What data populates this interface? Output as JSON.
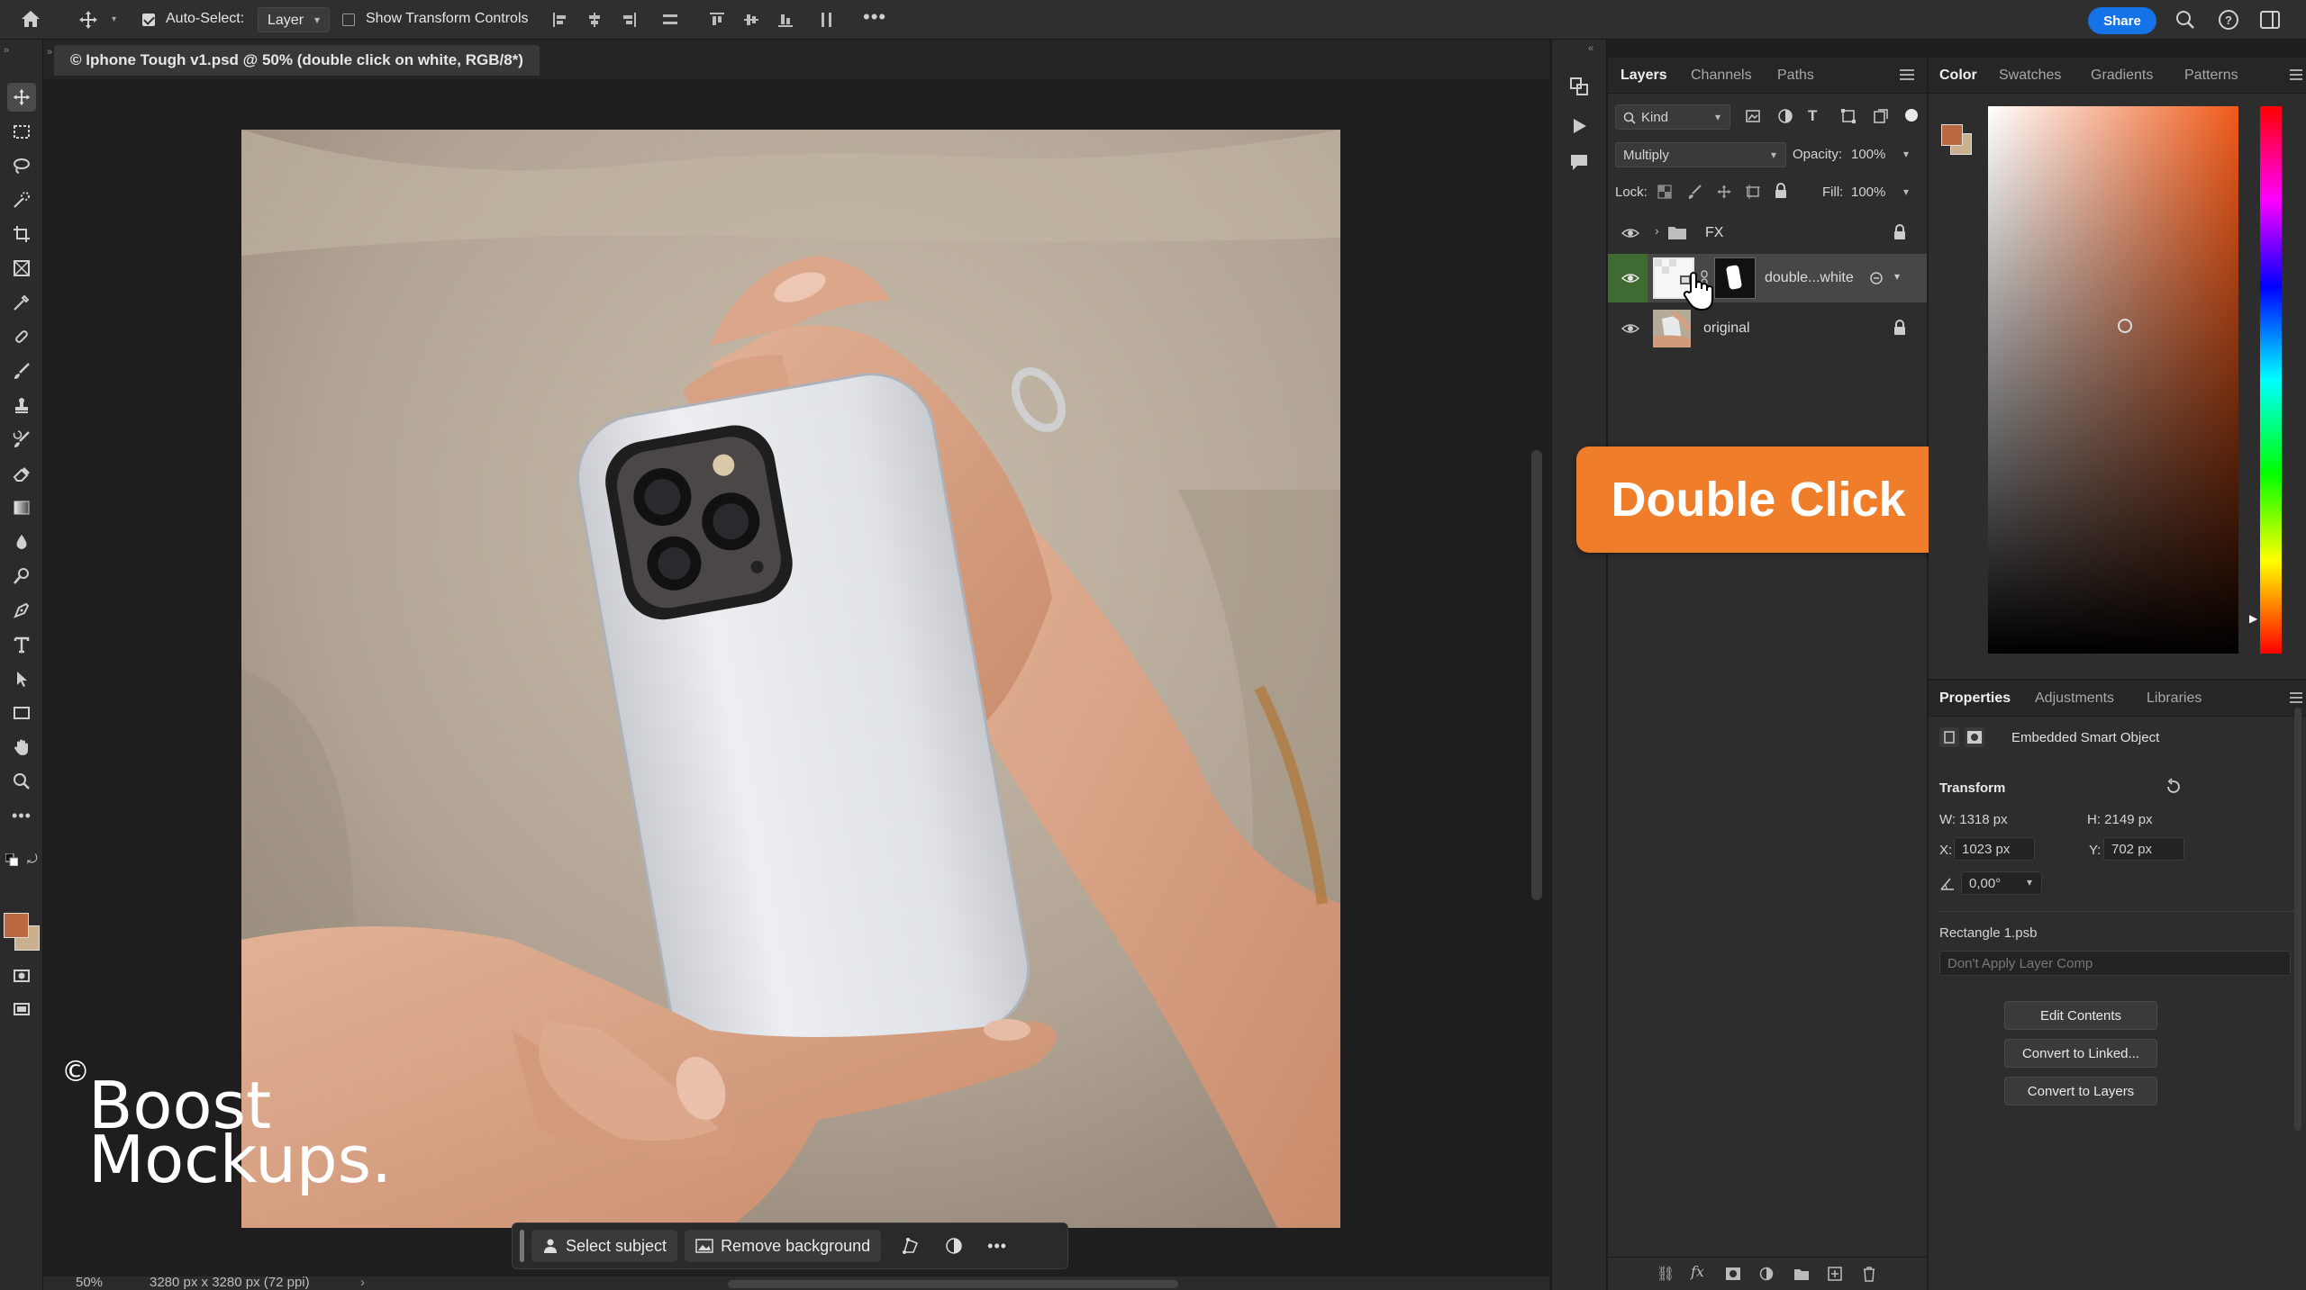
{
  "options_bar": {
    "auto_select_label": "Auto-Select:",
    "auto_select_value": "Layer",
    "show_transform_label": "Show Transform Controls",
    "share_label": "Share"
  },
  "document": {
    "tab_title": "© Iphone Tough v1.psd @ 50% (double click on white, RGB/8*)"
  },
  "contextual_bar": {
    "select_subject": "Select subject",
    "remove_background": "Remove background"
  },
  "status": {
    "zoom": "50%",
    "doc_size": "3280 px x 3280 px (72 ppi)"
  },
  "layers_panel": {
    "tabs": [
      "Layers",
      "Channels",
      "Paths"
    ],
    "filter_kind": "Kind",
    "blend_mode": "Multiply",
    "opacity_label": "Opacity:",
    "opacity_value": "100%",
    "lock_label": "Lock:",
    "fill_label": "Fill:",
    "fill_value": "100%",
    "layers": [
      {
        "name": "FX",
        "type": "group",
        "locked": true,
        "visible": true
      },
      {
        "name": "double...white",
        "type": "smart-object",
        "selected": true,
        "visible": true
      },
      {
        "name": "original",
        "type": "pixel",
        "locked": true,
        "visible": true
      }
    ]
  },
  "color_panel": {
    "tabs": [
      "Color",
      "Swatches",
      "Gradients",
      "Patterns"
    ],
    "foreground": "#b9683f",
    "background": "#c9b08e"
  },
  "properties_panel": {
    "tabs": [
      "Properties",
      "Adjustments",
      "Libraries"
    ],
    "object_type": "Embedded Smart Object",
    "transform_title": "Transform",
    "w": "W:  1318 px",
    "h": "H:  2149 px",
    "x_label": "X:",
    "x_value": "1023 px",
    "y_label": "Y:",
    "y_value": "702 px",
    "angle": "0,00°",
    "linked_file": "Rectangle 1.psb",
    "layer_comp": "Don't Apply Layer Comp",
    "edit_contents": "Edit Contents",
    "convert_linked": "Convert to Linked...",
    "convert_layers": "Convert to Layers"
  },
  "callout": {
    "text": "Double Click"
  },
  "watermark": {
    "copyright": "©",
    "line1": "Boost",
    "line2": "Mockups."
  }
}
